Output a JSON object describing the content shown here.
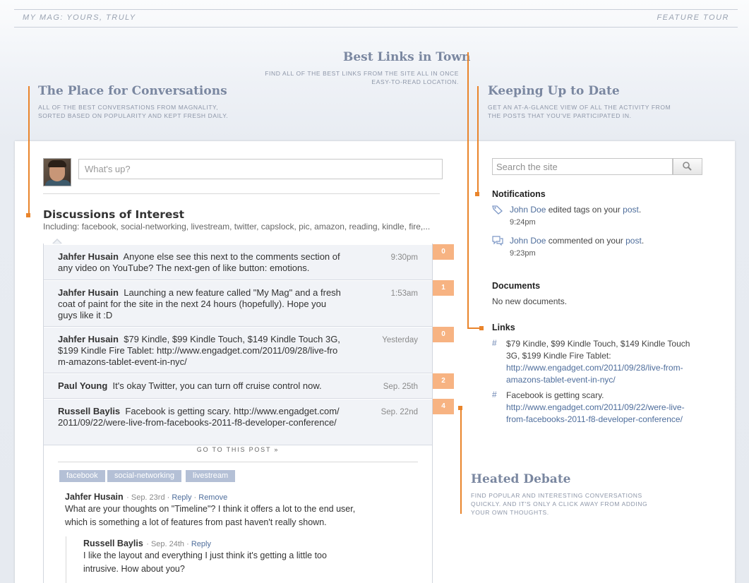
{
  "topbar": {
    "brand": "MY MAG: YOURS, TRULY",
    "tour": "FEATURE TOUR"
  },
  "features": {
    "best_links": {
      "title": "Best Links in Town",
      "desc_line1": "FIND ALL OF THE BEST LINKS FROM THE SITE ALL IN ONCE",
      "desc_line2": "EASY-TO-READ LOCATION."
    },
    "conversations": {
      "title": "The Place for Conversations",
      "desc_line1": "ALL OF THE BEST CONVERSATIONS FROM MAGNALITY,",
      "desc_line2": "SORTED BASED ON POPULARITY AND KEPT FRESH DAILY."
    },
    "up_to_date": {
      "title": "Keeping Up to Date",
      "desc_line1": "GET AN AT-A-GLANCE VIEW OF ALL THE ACTIVITY FROM",
      "desc_line2": "THE POSTS THAT YOU'VE PARTICIPATED IN."
    },
    "debate": {
      "title": "Heated Debate",
      "desc_line1": "FIND POPULAR AND INTERESTING CONVERSATIONS",
      "desc_line2": "QUICKLY.  AND IT'S ONLY A CLICK AWAY FROM  ADDING",
      "desc_line3": "YOUR OWN THOUGHTS."
    }
  },
  "composer": {
    "placeholder": "What's up?"
  },
  "discussions": {
    "title": "Discussions of Interest",
    "subtitle": "Including: facebook, social-networking, livestream, twitter, capslock, pic, amazon, reading, kindle, fire,...",
    "items": [
      {
        "author": "Jahfer Husain",
        "text": "Anyone else see this next to the comments section of any video on YouTube? The next-gen of like button: emotions.",
        "time": "9:30pm",
        "count": "0"
      },
      {
        "author": "Jahfer Husain",
        "text": "Launching a new feature called \"My Mag\" and a fresh coat of paint for the site in the next 24 hours (hopefully). Hope you guys like it :D",
        "time": "1:53am",
        "count": "1"
      },
      {
        "author": "Jahfer Husain",
        "text": "$79 Kindle, $99 Kindle Touch, $149 Kindle Touch 3G, $199 Kindle Fire Tablet: http://www.engadget.com/2011/09/28/live-from-amazons-tablet-event-in-nyc/",
        "time": "Yesterday",
        "count": "0"
      },
      {
        "author": "Paul Young",
        "text": "It's okay Twitter, you can turn off cruise control now.",
        "time": "Sep. 25th",
        "count": "2"
      },
      {
        "author": "Russell Baylis",
        "text": "Facebook is getting scary. http://www.engadget.com/2011/09/22/were-live-from-facebooks-2011-f8-developer-conference/",
        "time": "Sep. 22nd",
        "count": "4"
      }
    ],
    "goto": "GO TO THIS POST »",
    "tags": [
      "facebook",
      "social-networking",
      "livestream"
    ],
    "comments": [
      {
        "author": "Jahfer Husain",
        "date": "Sep. 23rd",
        "reply": "Reply",
        "remove": "Remove",
        "line1": "What are your thoughts on \"Timeline\"? I think it offers a lot to the end user,",
        "line2": "which is something a lot of features from past haven't really shown."
      },
      {
        "author": "Russell Baylis",
        "date": "Sep. 24th",
        "reply": "Reply",
        "line1": "I like the layout and everything I just think it's getting a little too",
        "line2": "intrusive. How about you?"
      }
    ]
  },
  "sidebar": {
    "search_placeholder": "Search the site",
    "notifications": {
      "title": "Notifications",
      "items": [
        {
          "user": "John Doe",
          "action": "edited tags on your",
          "target": "post",
          "time": "9:24pm",
          "icon": "tag-icon"
        },
        {
          "user": "John Doe",
          "action": "commented on your",
          "target": "post",
          "time": "9:23pm",
          "icon": "comment-icon"
        }
      ]
    },
    "documents": {
      "title": "Documents",
      "empty": "No new documents."
    },
    "links": {
      "title": "Links",
      "items": [
        {
          "line1": "$79 Kindle, $99 Kindle Touch, $149 Kindle Touch",
          "line2": "3G, $199 Kindle Fire Tablet:",
          "url1": "http://www.engadget.com/2011/09/28/live-from-",
          "url2": "amazons-tablet-event-in-nyc/"
        },
        {
          "line1": "Facebook is getting scary.",
          "url1": "http://www.engadget.com/2011/09/22/were-live-",
          "url2": "from-facebooks-2011-f8-developer-conference/"
        }
      ]
    }
  },
  "colors": {
    "accent": "#e9842b",
    "badge": "#f7b382",
    "link": "#4f6e9c",
    "feature_title": "#7a87a0"
  }
}
